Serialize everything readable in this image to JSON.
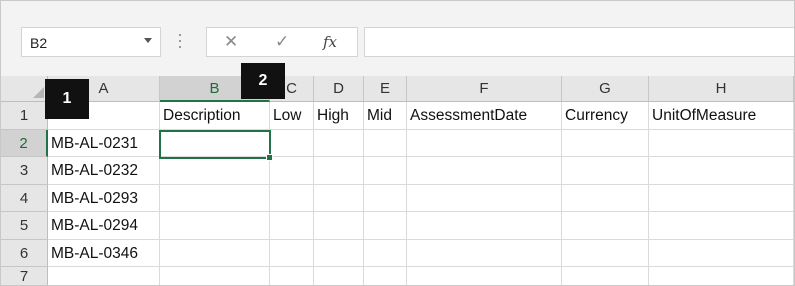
{
  "name_box": {
    "value": "B2"
  },
  "formula_bar": {
    "cancel_glyph": "✕",
    "enter_glyph": "✓",
    "fx_label": "fx",
    "value": ""
  },
  "columns": [
    "A",
    "B",
    "C",
    "D",
    "E",
    "F",
    "G",
    "H"
  ],
  "rows": [
    {
      "num": "1",
      "cells": [
        "",
        "Description",
        "Low",
        "High",
        "Mid",
        "AssessmentDate",
        "Currency",
        "UnitOfMeasure"
      ]
    },
    {
      "num": "2",
      "cells": [
        "MB-AL-0231",
        "",
        "",
        "",
        "",
        "",
        "",
        ""
      ]
    },
    {
      "num": "3",
      "cells": [
        "MB-AL-0232",
        "",
        "",
        "",
        "",
        "",
        "",
        ""
      ]
    },
    {
      "num": "4",
      "cells": [
        "MB-AL-0293",
        "",
        "",
        "",
        "",
        "",
        "",
        ""
      ]
    },
    {
      "num": "5",
      "cells": [
        "MB-AL-0294",
        "",
        "",
        "",
        "",
        "",
        "",
        ""
      ]
    },
    {
      "num": "6",
      "cells": [
        "MB-AL-0346",
        "",
        "",
        "",
        "",
        "",
        "",
        ""
      ]
    },
    {
      "num": "7",
      "cells": [
        "",
        "",
        "",
        "",
        "",
        "",
        "",
        ""
      ]
    }
  ],
  "callouts": [
    "1",
    "2"
  ],
  "colors": {
    "accent": "#217346",
    "callout_bg": "#111111"
  }
}
